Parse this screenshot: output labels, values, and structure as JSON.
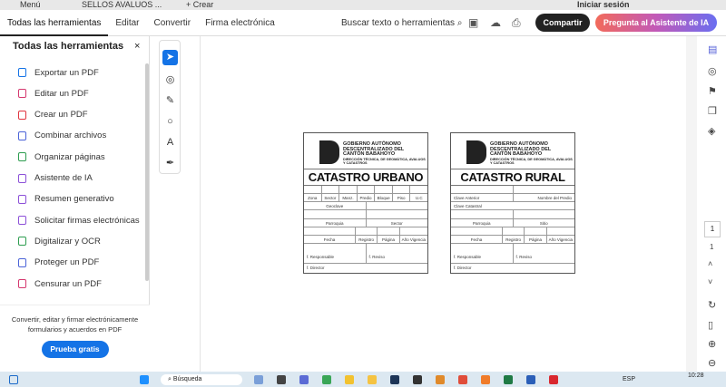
{
  "tabstrip": {
    "menu": "Menú",
    "tab": "SELLOS AVALUOS ...",
    "create": "+ Crear",
    "signin": "Iniciar sesión"
  },
  "toolbar": {
    "nav": [
      "Todas las herramientas",
      "Editar",
      "Convertir",
      "Firma electrónica"
    ],
    "search": "Buscar texto o herramientas",
    "share": "Compartir",
    "ai": "Pregunta al Asistente de IA"
  },
  "sidebar": {
    "title": "Todas las herramientas",
    "close": "×",
    "items": [
      {
        "label": "Exportar un PDF",
        "color": "#1473e6"
      },
      {
        "label": "Editar un PDF",
        "color": "#d5386f"
      },
      {
        "label": "Crear un PDF",
        "color": "#e0343f"
      },
      {
        "label": "Combinar archivos",
        "color": "#4b63d8"
      },
      {
        "label": "Organizar páginas",
        "color": "#2d9d4f"
      },
      {
        "label": "Asistente de IA",
        "color": "#8c50d8"
      },
      {
        "label": "Resumen generativo",
        "color": "#8c50d8"
      },
      {
        "label": "Solicitar firmas electrónicas",
        "color": "#8c50d8"
      },
      {
        "label": "Digitalizar y OCR",
        "color": "#2d9d4f"
      },
      {
        "label": "Proteger un PDF",
        "color": "#4b63d8"
      },
      {
        "label": "Censurar un PDF",
        "color": "#d5386f"
      }
    ],
    "footer_text": "Convertir, editar y firmar electrónicamente formularios y acuerdos en PDF",
    "trial": "Prueba gratis"
  },
  "page": {
    "number": "1",
    "total": "1"
  },
  "stamps": {
    "org": [
      "GOBIERNO AUTÓNOMO",
      "DESCENTRALIZADO DEL",
      "CANTÓN BABAHOYO"
    ],
    "dept": "DIRECCIÓN TÉCNICA, DE GEOMÁTICA, AVALUOS Y CATASTROS",
    "urban": {
      "title": "CATASTRO URBANO",
      "cols": [
        "Zona",
        "Sector",
        "Manz.",
        "Predio",
        "Bloque",
        "Piso",
        "U.C"
      ],
      "geoclave": "Geoclave",
      "parroquia": "Parroquia",
      "sector": "Sector",
      "fecha": "Fecha",
      "registro": "Registro",
      "pagina": "Página",
      "vigencia": "Año Vigencia",
      "responsable": "f. Responsable",
      "reviso": "f. Reviso",
      "director": "f. Director"
    },
    "rural": {
      "title": "CATASTRO RURAL",
      "clave_anterior": "Clave Anterior",
      "nombre": "Nombre del Predio",
      "clave_catastral": "Clave Catastral",
      "parroquia": "Parroquia",
      "sitio": "Sitio",
      "fecha": "Fecha",
      "registro": "Registro",
      "pagina": "Página",
      "vigencia": "Año Vigencia",
      "responsable": "f. Responsable",
      "reviso": "f. Reviso",
      "director": "f. Director"
    }
  },
  "taskbar": {
    "search": "Búsqueda",
    "lang": "ESP",
    "time": "10:28"
  }
}
